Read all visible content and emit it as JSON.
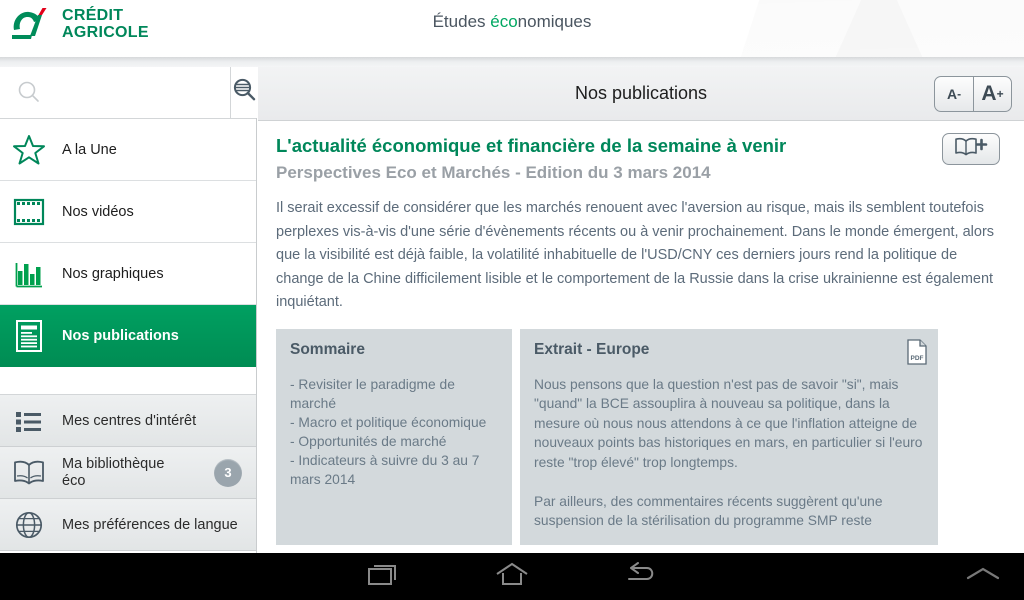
{
  "header": {
    "logo_line1": "CRÉDIT",
    "logo_line2": "AGRICOLE",
    "logo_name": "credit-agricole-logo",
    "title_part1": "Études ",
    "title_accent": "éco",
    "title_part3": "nomiques"
  },
  "sidebar": {
    "search": {
      "placeholder": "",
      "value": "",
      "icon": "search-icon",
      "button_icon": "advanced-search-icon"
    },
    "items": [
      {
        "label": "A la Une",
        "icon": "star-icon",
        "active": false
      },
      {
        "label": "Nos vidéos",
        "icon": "film-strip-icon",
        "active": false
      },
      {
        "label": "Nos graphiques",
        "icon": "bar-chart-icon",
        "active": false
      },
      {
        "label": "Nos publications",
        "icon": "document-icon",
        "active": true
      }
    ],
    "secondary_items": [
      {
        "label": "Mes centres d'intérêt",
        "icon": "list-icon",
        "badge": ""
      },
      {
        "label_line1": "Ma bibliothèque",
        "label_line2": "éco",
        "icon": "book-icon",
        "badge": "3"
      },
      {
        "label": "Mes préférences de langue",
        "icon": "globe-icon",
        "badge": ""
      }
    ]
  },
  "content": {
    "bar_title": "Nos publications",
    "font_decrease": "A",
    "font_decrease_sup": "-",
    "font_increase": "A",
    "font_increase_sup": "+",
    "article": {
      "title": "L'actualité économique et financière de la semaine à venir",
      "subtitle": "Perspectives Eco et Marchés - Edition du 3 mars 2014",
      "add_to_library_icon": "book-plus-icon",
      "body": "Il serait excessif de considérer que les marchés renouent avec l'aversion au risque, mais ils semblent toutefois perplexes vis-à-vis d'une série d'évènements récents ou à venir prochainement. Dans le monde émergent, alors que la visibilité est déjà faible, la volatilité inhabituelle de l'USD/CNY ces derniers jours rend la politique de change de la Chine difficilement lisible et le comportement de la Russie dans la crise ukrainienne est également inquiétant."
    },
    "panels": [
      {
        "title": "Sommaire",
        "body": "- Revisiter le paradigme de marché\n- Macro et politique économique\n- Opportunités de marché\n- Indicateurs à suivre du 3 au 7 mars 2014"
      },
      {
        "title": "Extrait - Europe",
        "pdf_icon": "pdf-icon",
        "pdf_label": "PDF",
        "body": "Nous pensons que la question n'est pas de savoir \"si\", mais \"quand\" la BCE assouplira à nouveau sa politique, dans la mesure où nous nous attendons à ce que l'inflation atteigne de nouveaux points bas historiques en mars, en particulier si l'euro reste \"trop élevé\" trop longtemps.\n\nPar ailleurs, des commentaires récents suggèrent qu'une suspension de la stérilisation du programme SMP reste"
      }
    ]
  },
  "android_nav": {
    "recents_icon": "recents-icon",
    "home_icon": "home-icon",
    "back_icon": "back-icon",
    "expand_icon": "chevron-up-icon"
  },
  "colors": {
    "brand_green": "#00875A",
    "accent_green": "#00A862",
    "body_text": "#5c6b7a",
    "panel_bg": "#d3d9dc",
    "badge_bg": "#9aa5ad"
  }
}
